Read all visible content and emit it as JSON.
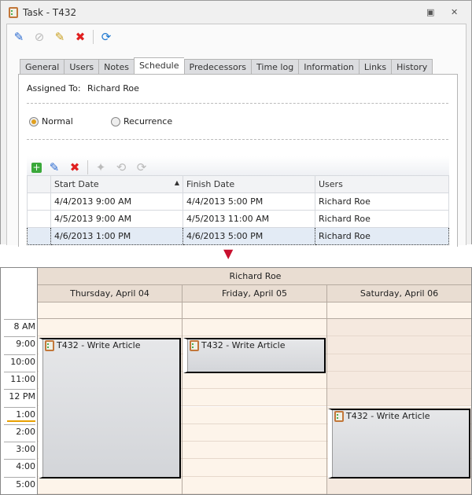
{
  "window": {
    "title": "Task - T432",
    "restore_icon": "restore-icon",
    "close_icon": "close-icon"
  },
  "toolbar": [
    "edit-icon",
    "cancel-icon",
    "edit-assign-icon",
    "delete-icon",
    "refresh-icon"
  ],
  "tabs": [
    "General",
    "Users",
    "Notes",
    "Schedule",
    "Predecessors",
    "Time log",
    "Information",
    "Links",
    "History"
  ],
  "active_tab": "Schedule",
  "schedule": {
    "assigned_label": "Assigned To:",
    "assigned_value": "Richard Roe",
    "radio_normal": "Normal",
    "radio_recurrence": "Recurrence",
    "selected": "Normal",
    "grid_toolbar": [
      "add-icon",
      "edit-icon",
      "delete-icon",
      "tool-disabled-icon",
      "recur-disabled-icon",
      "recur2-disabled-icon"
    ],
    "columns": [
      "Start Date",
      "Finish Date",
      "Users"
    ],
    "sort_indicator": "▲",
    "rows": [
      [
        "4/4/2013 9:00 AM",
        "4/4/2013 5:00 PM",
        "Richard Roe"
      ],
      [
        "4/5/2013 9:00 AM",
        "4/5/2013 11:00 AM",
        "Richard Roe"
      ],
      [
        "4/6/2013 1:00 PM",
        "4/6/2013 5:00 PM",
        "Richard Roe"
      ]
    ]
  },
  "arrow": "▼",
  "calendar": {
    "resource": "Richard Roe",
    "days": [
      "Thursday, April 04",
      "Friday, April 05",
      "Saturday, April 06"
    ],
    "hours": [
      "8 AM",
      "9:00",
      "10:00",
      "11:00",
      "12 PM",
      "1:00",
      "2:00",
      "3:00",
      "4:00",
      "5:00"
    ],
    "current_time": "1:00",
    "events": [
      {
        "day": 0,
        "title": "T432 - Write Article",
        "start": 9,
        "end": 17
      },
      {
        "day": 1,
        "title": "T432 - Write Article",
        "start": 9,
        "end": 11
      },
      {
        "day": 2,
        "title": "T432 - Write Article",
        "start": 13,
        "end": 17
      }
    ]
  }
}
